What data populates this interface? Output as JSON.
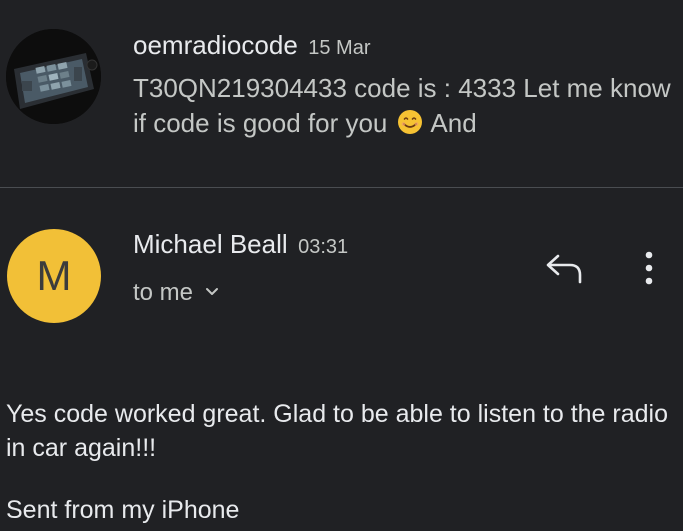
{
  "thread_item": {
    "sender": "oemradiocode",
    "date": "15 Mar",
    "snippet_before_emoji": "T30QN219304433 code is : 4333 Let me know if code is good for you",
    "snippet_after_emoji": "And",
    "emoji": "smiling-face-icon",
    "avatar": "car-radio-photo"
  },
  "message": {
    "avatar_letter": "M",
    "avatar_color": "#f2c037",
    "from_name": "Michael Beall",
    "time": "03:31",
    "to_label": "to me",
    "body": "Yes code worked great. Glad to be able to listen to the radio in car again!!!",
    "signature": "Sent from my iPhone"
  },
  "actions": {
    "reply_icon": "reply-icon",
    "more_icon": "more-vert-icon"
  },
  "colors": {
    "background": "#202124",
    "text_primary": "#e8eaed",
    "text_secondary": "#c4c7c5"
  }
}
